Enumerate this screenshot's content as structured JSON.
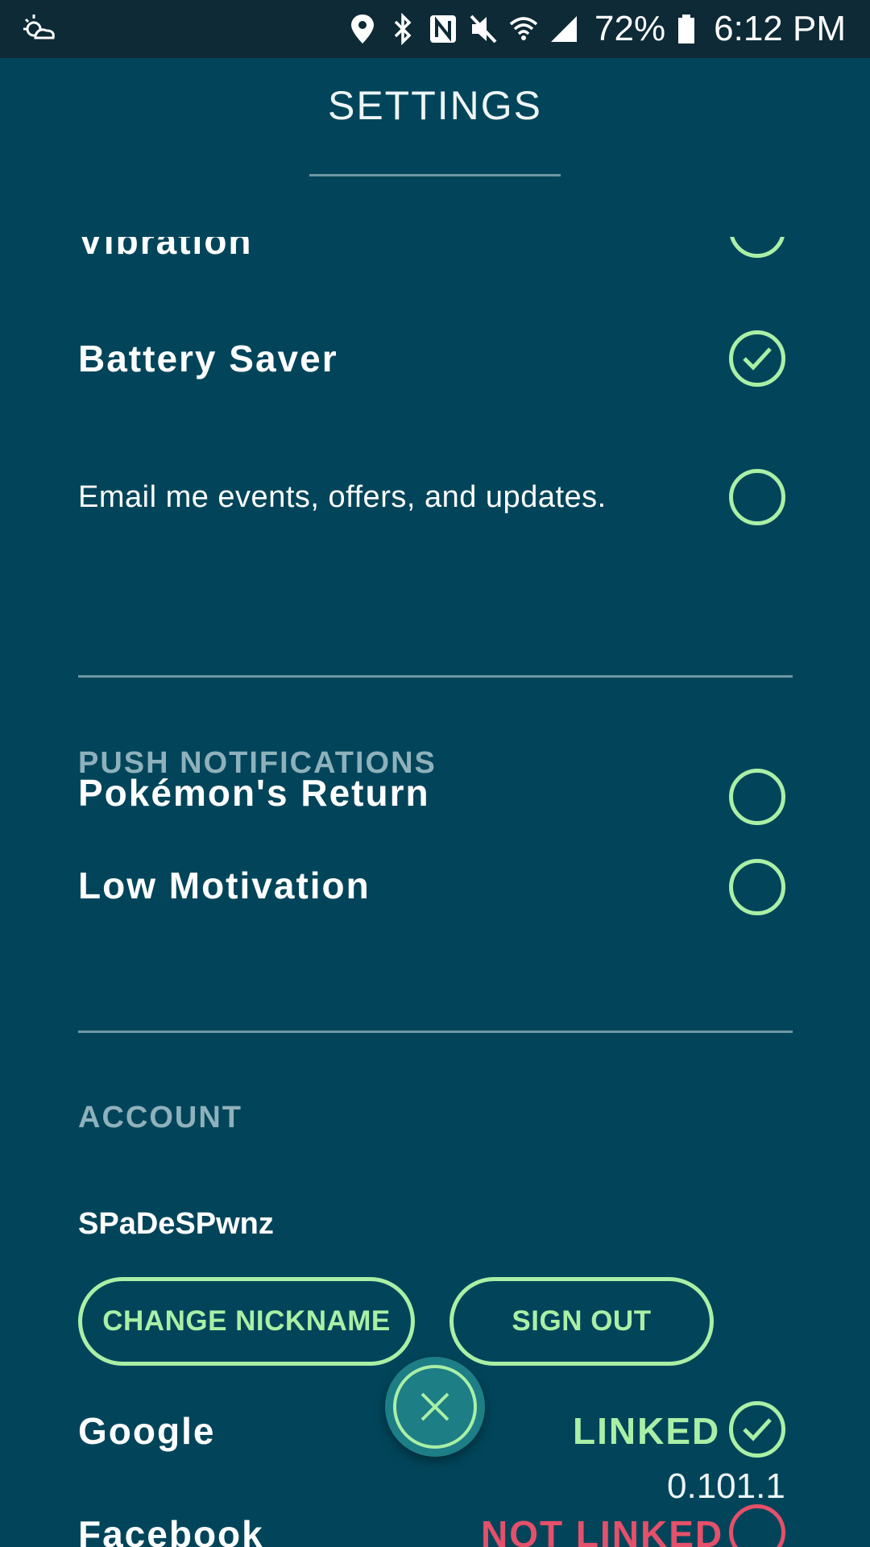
{
  "status_bar": {
    "battery": "72%",
    "time": "6:12 PM",
    "icons": [
      "weather-icon",
      "location-icon",
      "bluetooth-icon",
      "nfc-icon",
      "mute-icon",
      "wifi-icon",
      "signal-icon",
      "battery-icon"
    ]
  },
  "header": {
    "title": "SETTINGS"
  },
  "general": {
    "vibration_label": "Vibration",
    "battery_saver_label": "Battery Saver",
    "battery_saver_checked": true,
    "email_label": "Email me events, offers, and updates.",
    "email_checked": false
  },
  "push_notifications": {
    "header": "PUSH NOTIFICATIONS",
    "items": [
      {
        "label": "Pokémon's Return",
        "checked": false
      },
      {
        "label": "Low Motivation",
        "checked": false
      }
    ]
  },
  "account": {
    "header": "ACCOUNT",
    "nickname": "SPaDeSPwnz",
    "change_nickname_label": "CHANGE NICKNAME",
    "sign_out_label": "SIGN OUT",
    "google_label": "Google",
    "google_status": "LINKED",
    "facebook_label": "Facebook",
    "facebook_status": "NOT LINKED"
  },
  "version": "0.101.1",
  "colors": {
    "background": "#02455a",
    "accent_green": "#a9f0a6",
    "accent_red": "#e5506a",
    "status_bar": "#0d2a36"
  }
}
